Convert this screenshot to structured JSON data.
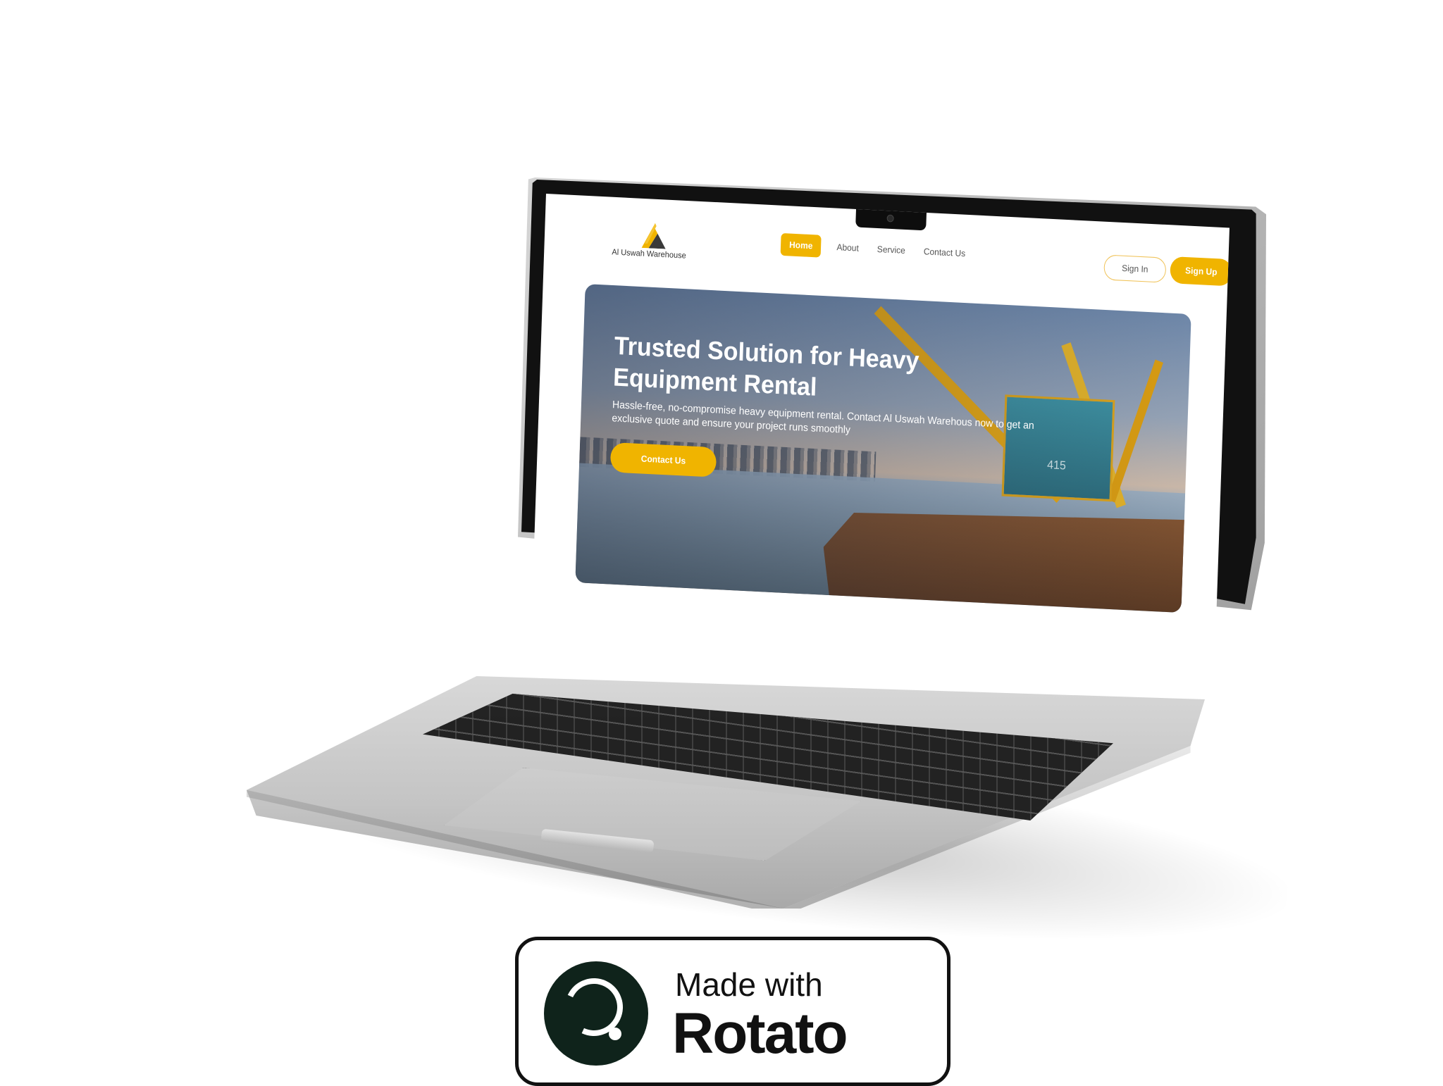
{
  "website": {
    "brand": {
      "name": "Al Uswah Warehouse",
      "logo_icon": "triangle-peak-logo"
    },
    "nav": {
      "links": [
        {
          "label": "Home",
          "active": true
        },
        {
          "label": "About",
          "active": false
        },
        {
          "label": "Service",
          "active": false
        },
        {
          "label": "Contact Us",
          "active": false
        }
      ]
    },
    "auth": {
      "sign_in_label": "Sign In",
      "sign_up_label": "Sign Up"
    },
    "hero": {
      "title": "Trusted Solution for Heavy Equipment Rental",
      "subtitle": "Hassle-free, no-compromise heavy equipment rental. Contact Al Uswah Warehous now to get an exclusive quote and ensure your project runs smoothly",
      "cta_label": "Contact Us",
      "crane_number": "415"
    }
  },
  "badge": {
    "line1": "Made with",
    "line2": "Rotato",
    "icon": "rotato-logo-icon"
  },
  "colors": {
    "accent": "#f0b400",
    "text": "#333333",
    "badge_dark": "#0f231b"
  }
}
